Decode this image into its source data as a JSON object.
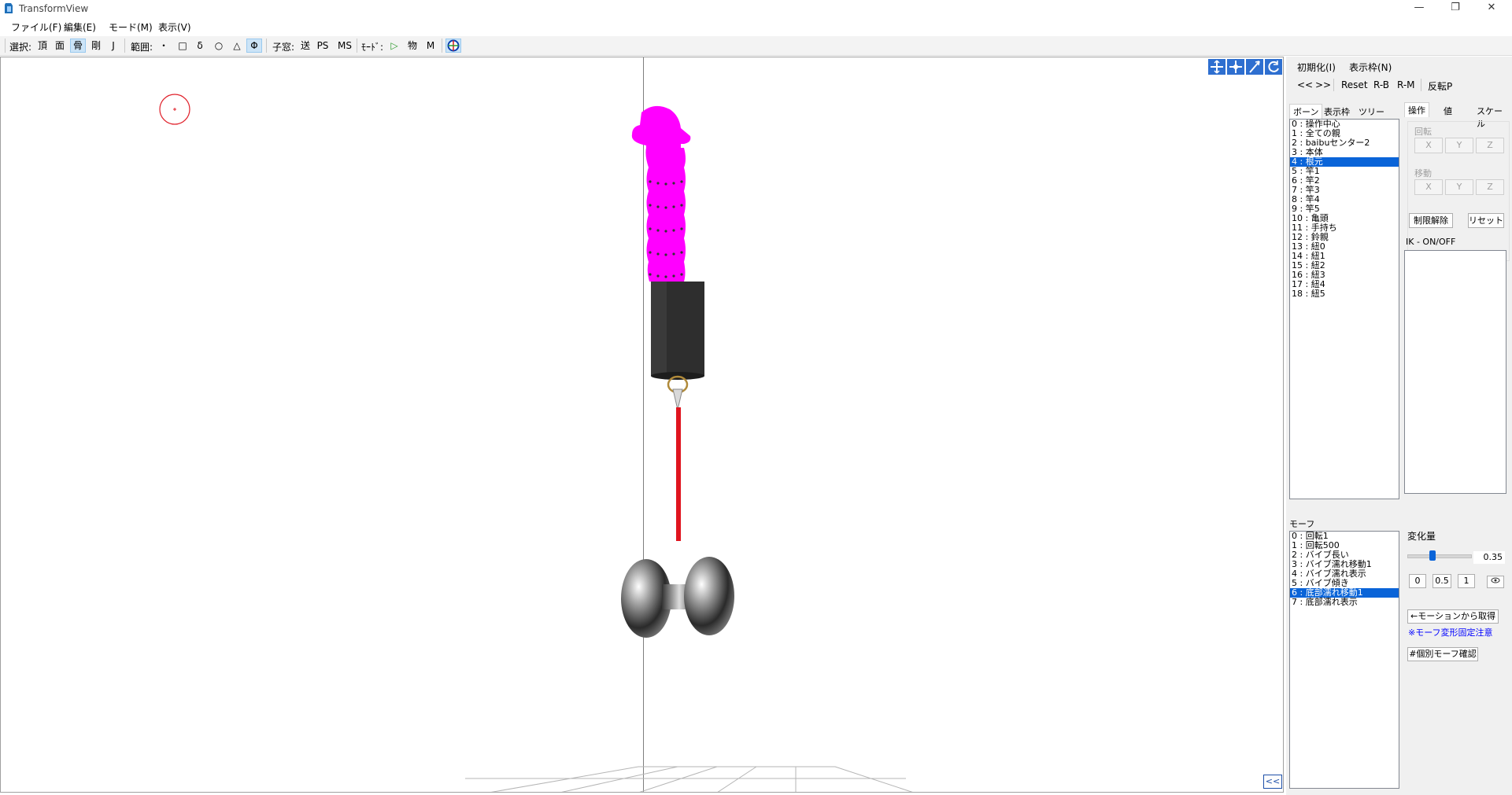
{
  "window": {
    "title": "TransformView",
    "controls": {
      "minimize": "—",
      "maximize": "❐",
      "close": "✕"
    }
  },
  "menu": [
    "ファイル(F)",
    "編集(E)",
    "モード(M)",
    "表示(V)"
  ],
  "toolbar": {
    "select_label": "選択:",
    "select_items": [
      "頂",
      "面",
      "骨",
      "剛",
      "J"
    ],
    "range_label": "範囲:",
    "range_items": [
      "・",
      "□",
      "δ",
      "○",
      "△",
      "Φ"
    ],
    "child_label": "子窓:",
    "child_items": [
      "送",
      "PS",
      "MS"
    ],
    "mode_label": "ﾓｰﾄﾞ:",
    "mode_items": [
      "▷",
      "物",
      "M"
    ]
  },
  "panel": {
    "init_button": "初期化(I)",
    "display_frame_button": "表示枠(N)",
    "nav": [
      "<<",
      ">>",
      "Reset",
      "R-B",
      "R-M",
      "反転P"
    ],
    "left_tabs": [
      "ボーン",
      "表示枠",
      "ツリー"
    ],
    "right_tabs": [
      "操作",
      "値",
      "スケール"
    ],
    "bones": [
      "0 : 操作中心",
      "1 : 全ての親",
      "2 : baibuセンター2",
      "3 : 本体",
      "4 : 根元",
      "5 : 竿1",
      "6 : 竿2",
      "7 : 竿3",
      "8 : 竿4",
      "9 : 竿5",
      "10 : 亀頭",
      "11 : 手持ち",
      "12 : 鈴親",
      "13 : 紐0",
      "14 : 紐1",
      "15 : 紐2",
      "16 : 紐3",
      "17 : 紐4",
      "18 : 紐5"
    ],
    "selected_bone_index": 4,
    "rotation_label": "回転",
    "move_label": "移動",
    "axes": [
      "X",
      "Y",
      "Z"
    ],
    "unlimit_button": "制限解除",
    "reset_button": "リセット",
    "ik_label": "IK - ON/OFF",
    "morph_label": "モーフ",
    "morphs": [
      "0 : 回転1",
      "1 : 回転500",
      "2 : バイブ長い",
      "3 : バイブ濡れ移動1",
      "4 : バイブ濡れ表示",
      "5 : バイブ傾き",
      "6 : 底部濡れ移動1",
      "7 : 底部濡れ表示"
    ],
    "selected_morph_index": 6,
    "change_label": "変化量",
    "change_value": "0.35",
    "slider_fraction": 0.35,
    "preset_buttons": [
      "0",
      "0.5",
      "1"
    ],
    "motion_button": "←モーションから取得",
    "morph_warning": "※モーフ変形固定注意",
    "individual_morph_button": "#個別モーフ確認",
    "accent_color": "#0a64d8",
    "warning_color": "#0000ff"
  },
  "viewport": {
    "collapse_button": "<<",
    "model_color": "#ff00ff"
  }
}
